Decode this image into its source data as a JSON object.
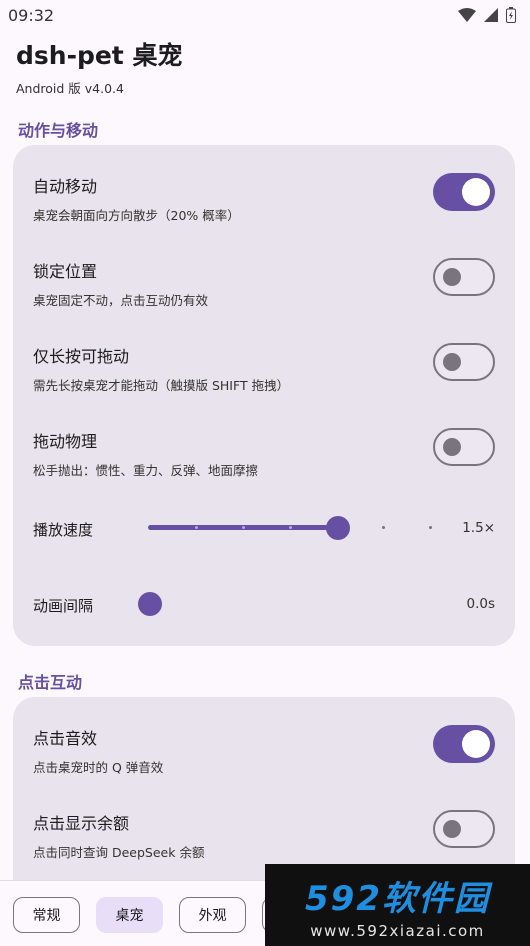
{
  "status_bar": {
    "time": "09:32",
    "icons": [
      "wifi-icon",
      "signal-icon",
      "battery-icon"
    ]
  },
  "header": {
    "title": "dsh-pet 桌宠",
    "version": "Android 版 v4.0.4"
  },
  "sections": {
    "movement": {
      "title": "动作与移动",
      "toggles": [
        {
          "title": "自动移动",
          "subtitle": "桌宠会朝面向方向散步（20% 概率）",
          "on": true
        },
        {
          "title": "锁定位置",
          "subtitle": "桌宠固定不动，点击互动仍有效",
          "on": false
        },
        {
          "title": "仅长按可拖动",
          "subtitle": "需先长按桌宠才能拖动（触摸版 SHIFT 拖拽）",
          "on": false
        },
        {
          "title": "拖动物理",
          "subtitle": "松手抛出：惯性、重力、反弹、地面摩擦",
          "on": false
        }
      ],
      "speed": {
        "label": "播放速度",
        "value": "1.5×",
        "fraction": 0.667
      },
      "interval": {
        "label": "动画间隔",
        "value": "0.0s",
        "fraction": 0
      }
    },
    "click": {
      "title": "点击互动",
      "toggles": [
        {
          "title": "点击音效",
          "subtitle": "点击桌宠时的 Q 弹音效",
          "on": true
        },
        {
          "title": "点击显示余额",
          "subtitle": "点击同时查询 DeepSeek 余额",
          "on": false
        }
      ]
    }
  },
  "bottom_nav": {
    "tabs": [
      "常规",
      "桌宠",
      "外观"
    ],
    "active": "桌宠"
  },
  "watermark": {
    "logo": "592软件园",
    "url": "www.592xiazai.com"
  },
  "colors": {
    "accent": "#6750a4",
    "card": "#e8e3ec",
    "background": "#fcf8fd"
  }
}
